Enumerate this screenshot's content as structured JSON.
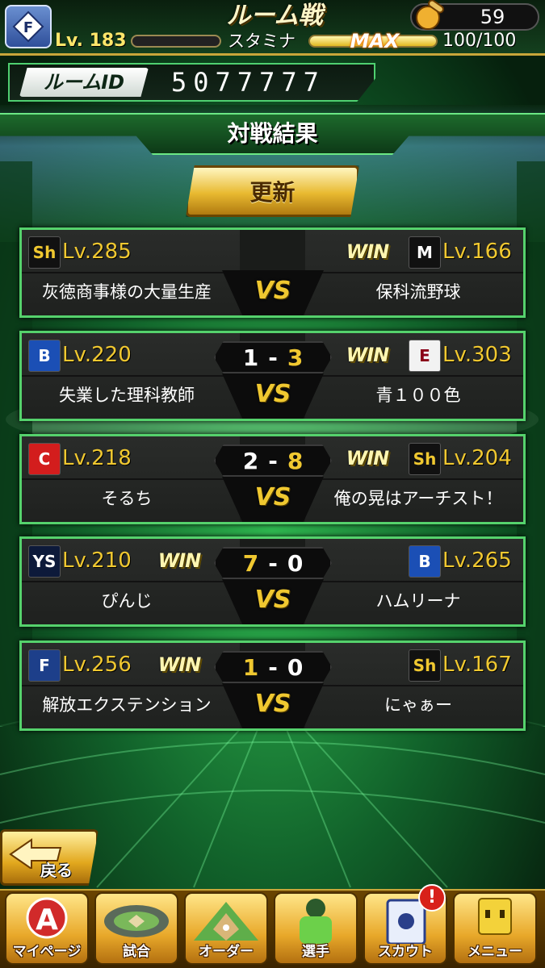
{
  "header": {
    "title": "ルーム戦",
    "token_count": "59",
    "level": "Lv. 183",
    "stamina_label": "スタミナ",
    "stamina_max": "MAX",
    "stamina_value": "100/100"
  },
  "room": {
    "label": "ルームID",
    "value": "5077777"
  },
  "section": {
    "title": "対戦結果"
  },
  "refresh_button": "更新",
  "vs_label": "VS",
  "win_label": "WIN",
  "score_separator": "-",
  "matches": [
    {
      "left": {
        "logo": "Sh",
        "level": "Lv.285",
        "name": "灰徳商事様の大量生産"
      },
      "right": {
        "logo": "M",
        "level": "Lv.166",
        "name": "保科流野球"
      },
      "winner": "right",
      "score_left": "",
      "score_right": ""
    },
    {
      "left": {
        "logo": "B",
        "level": "Lv.220",
        "name": "失業した理科教師"
      },
      "right": {
        "logo": "E",
        "level": "Lv.303",
        "name": "青１００色"
      },
      "winner": "right",
      "score_left": "1",
      "score_right": "3"
    },
    {
      "left": {
        "logo": "C",
        "level": "Lv.218",
        "name": "そるち"
      },
      "right": {
        "logo": "Sh",
        "level": "Lv.204",
        "name": "俺の晃はアーチスト！"
      },
      "winner": "right",
      "score_left": "2",
      "score_right": "8"
    },
    {
      "left": {
        "logo": "YS",
        "level": "Lv.210",
        "name": "ぴんじ"
      },
      "right": {
        "logo": "B",
        "level": "Lv.265",
        "name": "ハムリーナ"
      },
      "winner": "left",
      "score_left": "7",
      "score_right": "0"
    },
    {
      "left": {
        "logo": "F",
        "level": "Lv.256",
        "name": "解放エクステンション"
      },
      "right": {
        "logo": "Sh",
        "level": "Lv.167",
        "name": "にゃぁー"
      },
      "winner": "left",
      "score_left": "1",
      "score_right": "0"
    }
  ],
  "back_button": "戻る",
  "nav": [
    {
      "label": "マイページ",
      "icon": "mypage-icon"
    },
    {
      "label": "試合",
      "icon": "stadium-icon"
    },
    {
      "label": "オーダー",
      "icon": "field-icon"
    },
    {
      "label": "選手",
      "icon": "player-icon"
    },
    {
      "label": "スカウト",
      "icon": "scout-icon"
    },
    {
      "label": "メニュー",
      "icon": "menu-icon"
    }
  ],
  "alert_badge": "!",
  "team_badge": "F",
  "colors": {
    "accent_green": "#55d26c",
    "gold": "#f0c830",
    "win": "#fff6b0"
  }
}
